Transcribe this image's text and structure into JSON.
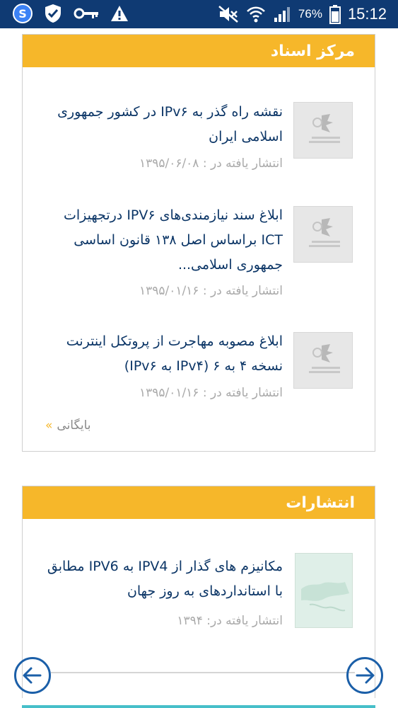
{
  "status_bar": {
    "app_letter": "S",
    "battery_percent": "76%",
    "time": "15:12"
  },
  "documents": {
    "header": "مرکز اسناد",
    "items": [
      {
        "title": "نقشه راه گذر به IPv۶ در کشور جمهوری اسلامی ایران",
        "date": "انتشار یافته در : ۱۳۹۵/۰۶/۰۸"
      },
      {
        "title": "ابلاغ سند نیازمندی‌های IPV۶ درتجهیزات ICT براساس اصل ۱۳۸ قانون اساسی جمهوری اسلامی...",
        "date": "انتشار یافته در : ۱۳۹۵/۰۱/۱۶"
      },
      {
        "title": "ابلاغ مصوبه مهاجرت از پروتکل اینترنت نسخه ۴ به ۶ (IPv۴ به IPv۶)",
        "date": "انتشار یافته در : ۱۳۹۵/۰۱/۱۶"
      }
    ],
    "archive_label": "بایگانی"
  },
  "publications": {
    "header": "انتشارات",
    "items": [
      {
        "title": "مکانیزم های گذار از IPV4 به IPV6 مطابق با استانداردهای به روز جهان",
        "date": "انتشار یافته در: ۱۳۹۴"
      }
    ]
  }
}
